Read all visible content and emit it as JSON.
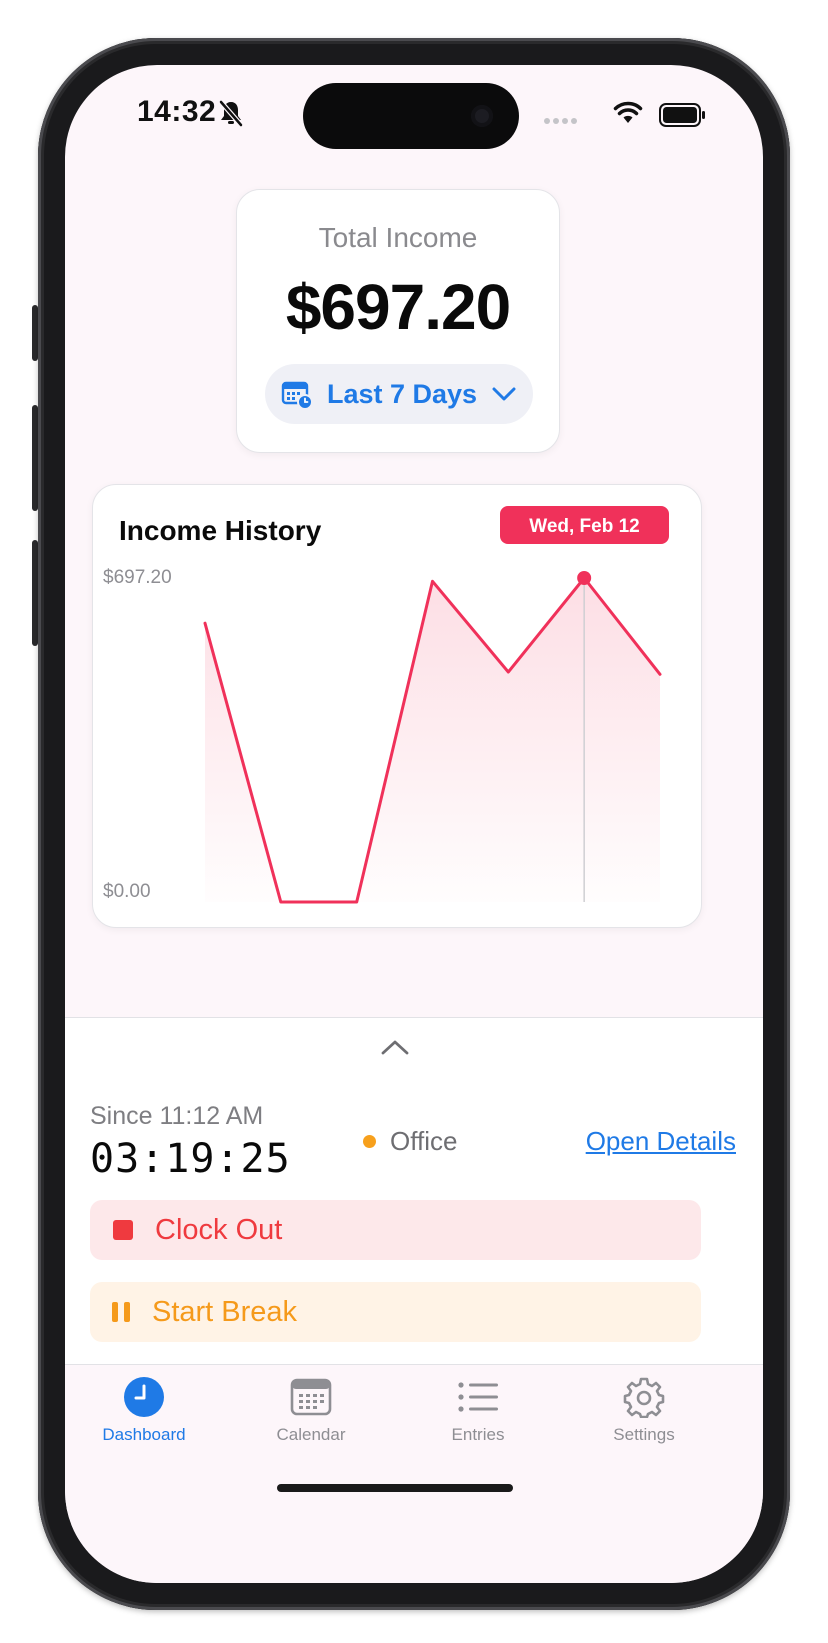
{
  "status_bar": {
    "time": "14:32",
    "silent_icon": "bell-slash-icon",
    "signal_icon": "cellular-signal-icon",
    "wifi_icon": "wifi-icon",
    "battery_icon": "battery-icon"
  },
  "summary": {
    "label": "Total Income",
    "value": "$697.20",
    "range": {
      "label": "Last 7 Days",
      "icon": "calendar-clock-icon",
      "chevron_icon": "chevron-down-icon"
    }
  },
  "chart_data": {
    "type": "line",
    "title": "Income History",
    "y_labels": [
      "$697.20",
      "$0.00"
    ],
    "ylim": [
      0,
      697.2
    ],
    "selected_label": "Wed, Feb 12",
    "selected_index": 5,
    "values": [
      600,
      0,
      0,
      690,
      495,
      697.2,
      490
    ],
    "line_color": "#f0315a",
    "grid": false,
    "legend": "none"
  },
  "sheet": {
    "collapse_icon": "chevron-up-icon",
    "since": "Since 11:12 AM",
    "elapsed": "03:19:25",
    "location": "Office",
    "location_color": "#f7a01c",
    "open_details": "Open Details",
    "clock_out": "Clock Out",
    "start_break": "Start Break"
  },
  "tabs": [
    {
      "label": "Dashboard",
      "icon": "clock-icon",
      "active": true
    },
    {
      "label": "Calendar",
      "icon": "calendar-icon",
      "active": false
    },
    {
      "label": "Entries",
      "icon": "list-icon",
      "active": false
    },
    {
      "label": "Settings",
      "icon": "gear-icon",
      "active": false
    }
  ],
  "colors": {
    "accent": "#1f7ae6",
    "danger": "#ef3a3f",
    "warning": "#f59a1b",
    "chart": "#f0315a"
  }
}
